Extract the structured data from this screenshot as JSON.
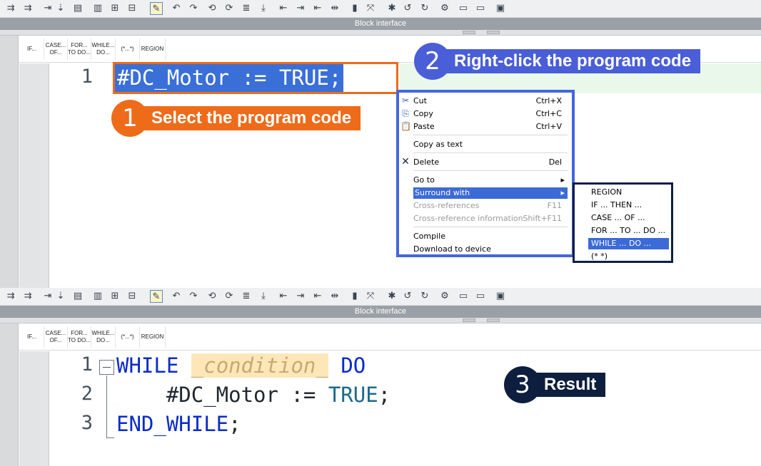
{
  "toolbar_icons": [
    "⇉",
    "⇉",
    "⇥",
    "⇣",
    "▤",
    "▥",
    "⊞",
    "⊟",
    "✎",
    "↶",
    "↷",
    "⟲",
    "⟳",
    "≣",
    "⤓",
    "⇤",
    "⇥",
    "⇤",
    "⇹",
    "▮",
    "⤧",
    "✱",
    "↺",
    "↻",
    "⚙",
    "▭",
    "▭",
    "▣"
  ],
  "block_interface_label": "Block interface",
  "keyword_buttons": [
    "IF...",
    "CASE...\nOF...",
    "FOR...\nTO DO...",
    "WHILE...\nDO...",
    "(*...*)",
    "REGION"
  ],
  "top_editor": {
    "line_number": "1",
    "code": "#DC_Motor := TRUE;"
  },
  "callouts": {
    "step1": {
      "number": "1",
      "text": "Select the program code",
      "color": "#ee6b1a"
    },
    "step2": {
      "number": "2",
      "text": "Right-click the program code",
      "color": "#4a5ed8"
    },
    "step3": {
      "number": "3",
      "text": "Result",
      "color": "#0d1e3e"
    }
  },
  "context_menu": {
    "cut": {
      "label": "Cut",
      "shortcut": "Ctrl+X",
      "icon": "scissors-icon"
    },
    "copy": {
      "label": "Copy",
      "shortcut": "Ctrl+C",
      "icon": "copy-icon"
    },
    "paste": {
      "label": "Paste",
      "shortcut": "Ctrl+V",
      "icon": "paste-icon"
    },
    "copy_as_text": {
      "label": "Copy as text"
    },
    "delete": {
      "label": "Delete",
      "shortcut": "Del",
      "icon": "delete-icon"
    },
    "go_to": {
      "label": "Go to"
    },
    "surround_with": {
      "label": "Surround with"
    },
    "cross_references": {
      "label": "Cross-references",
      "shortcut": "F11"
    },
    "cross_reference_information": {
      "label": "Cross-reference information",
      "shortcut": "Shift+F11"
    },
    "compile": {
      "label": "Compile"
    },
    "download_to_device": {
      "label": "Download to device"
    }
  },
  "surround_submenu": [
    "REGION",
    "IF ... THEN ...",
    "CASE ... OF ...",
    "FOR ... TO ... DO ...",
    "WHILE ... DO ...",
    "(*  *)"
  ],
  "bottom_editor": {
    "line_numbers": [
      "1",
      "2",
      "3"
    ],
    "while_kw": "WHILE",
    "condition": "_condition_",
    "do_kw": "DO",
    "statement": "#DC_Motor := ",
    "true_kw": "TRUE",
    "semicolon": ";",
    "end_while_kw": "END_WHILE",
    "end_semicolon": ";"
  },
  "colors": {
    "selection_bg": "#3a6fd8",
    "menu_border": "#4466dd",
    "submenu_border": "#0e1f44",
    "highlight": "#3c6ad6"
  }
}
